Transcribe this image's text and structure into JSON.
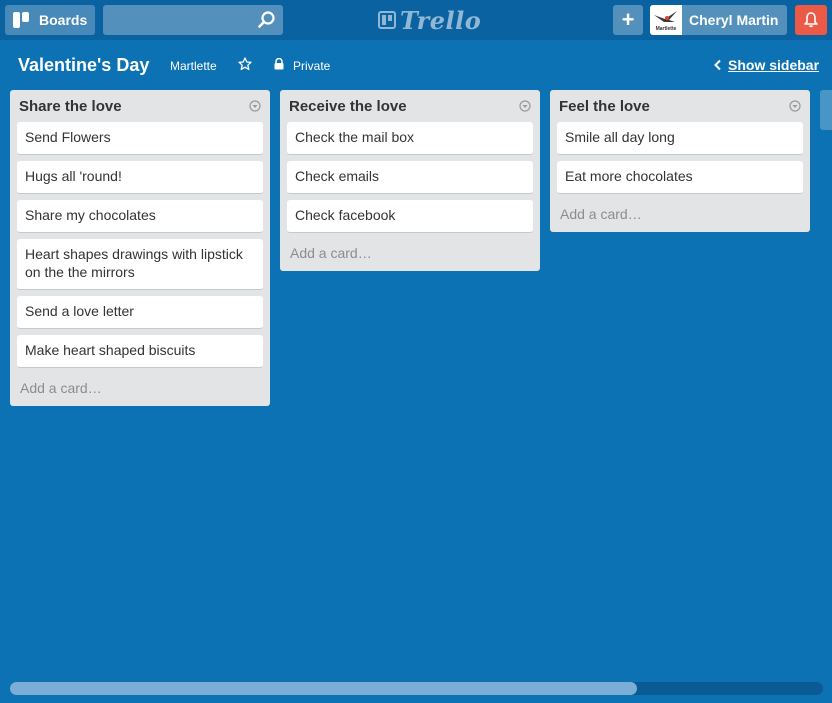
{
  "header": {
    "boards_label": "Boards",
    "search_value": "",
    "logo_text": "Trello",
    "add_label": "+",
    "member_name": "Cheryl Martin",
    "avatar_text": "Martlette"
  },
  "board": {
    "title": "Valentine's Day",
    "organization": "Martlette",
    "visibility": "Private",
    "show_sidebar": "Show sidebar"
  },
  "lists": [
    {
      "title": "Share the love",
      "cards": [
        "Send Flowers",
        "Hugs all 'round!",
        "Share my chocolates",
        "Heart shapes drawings with lipstick on the the mirrors",
        "Send a love letter",
        "Make heart shaped biscuits"
      ],
      "add_card": "Add a card…"
    },
    {
      "title": "Receive the love",
      "cards": [
        "Check the mail box",
        "Check emails",
        "Check facebook"
      ],
      "add_card": "Add a card…"
    },
    {
      "title": "Feel the love",
      "cards": [
        "Smile all day long",
        "Eat more chocolates"
      ],
      "add_card": "Add a card…"
    }
  ],
  "colors": {
    "board_bg": "#0c72b3",
    "header_bg": "#0a62a0",
    "list_bg": "#e2e4e6",
    "notification": "#eb5a46"
  },
  "icons": {
    "boards": "boards-icon",
    "search": "search-icon",
    "add": "plus-icon",
    "notification": "bell-icon",
    "star": "star-icon",
    "lock": "lock-icon",
    "list_menu": "chevron-circle-icon",
    "sidebar": "chevron-left-icon"
  }
}
